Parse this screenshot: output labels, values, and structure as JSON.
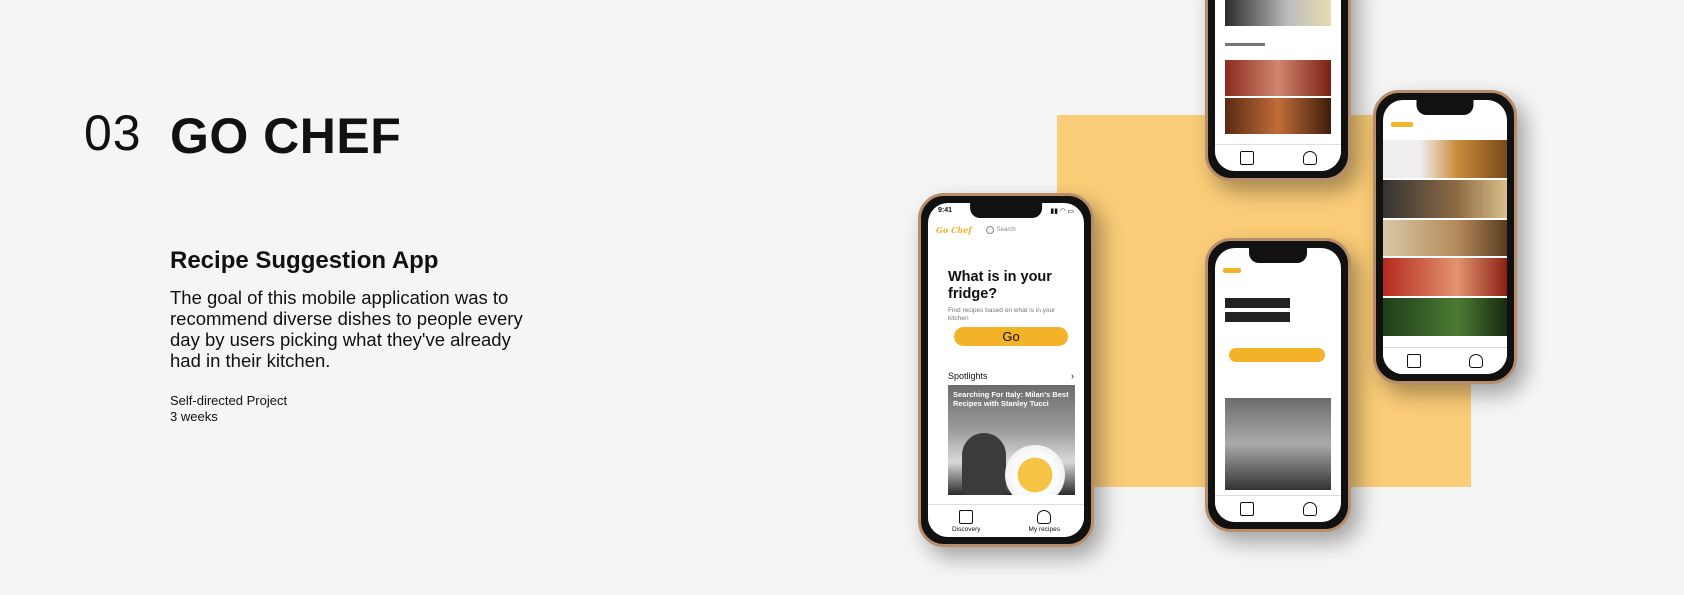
{
  "header": {
    "number": "03",
    "title": "GO CHEF"
  },
  "project": {
    "subtitle": "Recipe Suggestion App",
    "description": "The goal of this mobile application was to recommend diverse dishes to people every day by users picking what they've already had in their kitchen.",
    "type": "Self-directed Project",
    "duration": "3 weeks"
  },
  "colors": {
    "accent": "#f2b329",
    "panel": "#fbcd78",
    "background": "#f5f5f5"
  },
  "phone_main": {
    "time": "9:41",
    "logo": "Go Chef",
    "search_placeholder": "Search",
    "hero_title": "What is in your fridge?",
    "hero_text": "Find recipes based on what is in your kitchen",
    "go_label": "Go",
    "spotlights_label": "Spotlights",
    "chevron": "›",
    "card_title": "Searching For Italy: Milan's Best Recipes with Stanley Tucci",
    "tabs": [
      {
        "label": "Discovery",
        "icon": "chef-hat-icon"
      },
      {
        "label": "My recipes",
        "icon": "profile-icon"
      }
    ]
  }
}
